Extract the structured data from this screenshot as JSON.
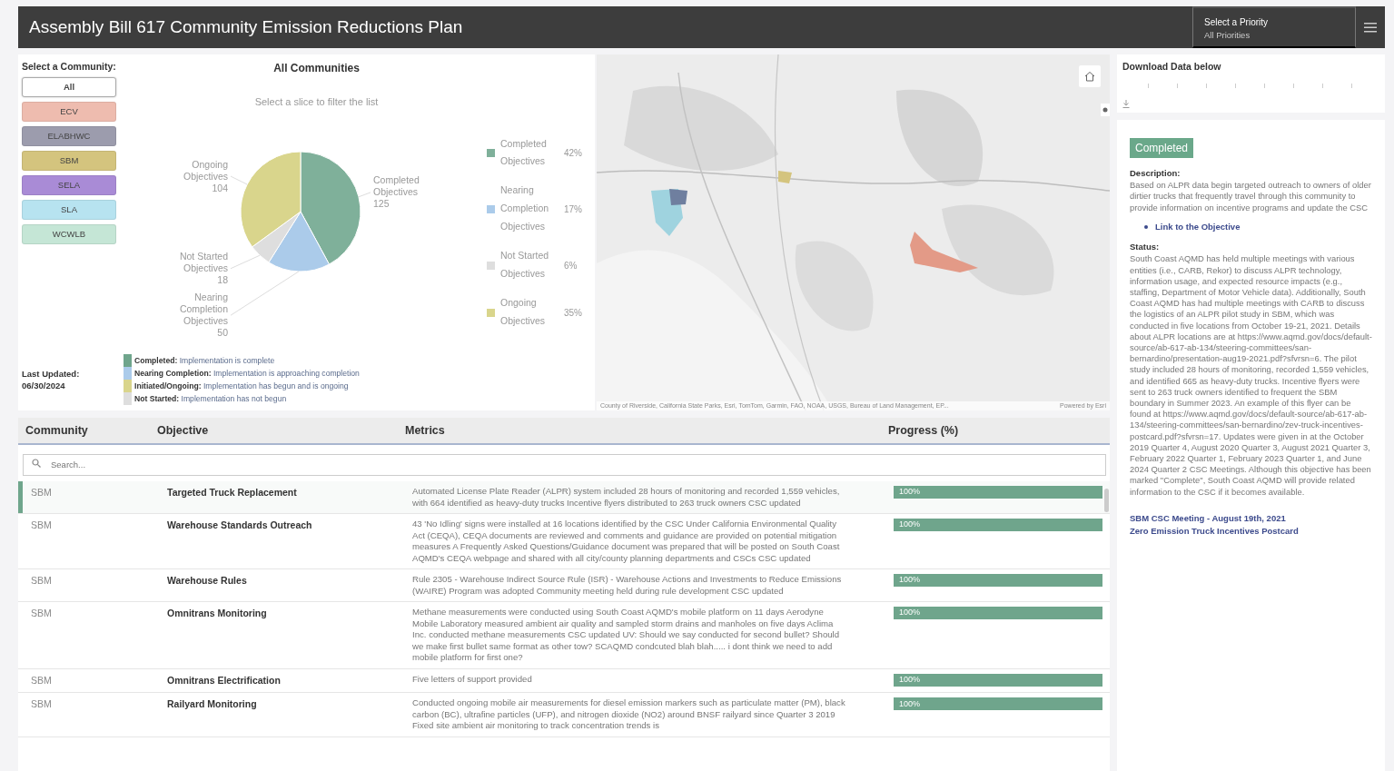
{
  "header": {
    "title": "Assembly Bill 617 Community Emission Reductions Plan",
    "priority_select": {
      "label": "Select a Priority",
      "value": "All Priorities"
    }
  },
  "community_selector": {
    "label": "Select a Community:",
    "options": [
      {
        "label": "All",
        "color": "#ffffff",
        "selected": true
      },
      {
        "label": "ECV",
        "color": "#eebcaf",
        "selected": false
      },
      {
        "label": "ELABHWC",
        "color": "#9c9cad",
        "selected": false
      },
      {
        "label": "SBM",
        "color": "#d4c47e",
        "selected": false
      },
      {
        "label": "SELA",
        "color": "#a98bd6",
        "selected": false
      },
      {
        "label": "SLA",
        "color": "#b7e3f0",
        "selected": false
      },
      {
        "label": "WCWLB",
        "color": "#c5e6d6",
        "selected": false
      }
    ]
  },
  "last_updated": {
    "label": "Last Updated:",
    "value": "06/30/2024"
  },
  "chart": {
    "subtitle": "Select a slice to filter the list",
    "chart_data": {
      "type": "pie",
      "title": "All Communities",
      "categories": [
        "Completed Objectives",
        "Nearing Completion Objectives",
        "Not Started Objectives",
        "Ongoing Objectives"
      ],
      "series": [
        {
          "values": [
            125,
            50,
            18,
            104
          ]
        }
      ],
      "data_labels": true
    },
    "legend": [
      {
        "label": "Completed Objectives",
        "percent": "42%",
        "color": "#7fb09a"
      },
      {
        "label": "Nearing Completion Objectives",
        "percent": "17%",
        "color": "#abcbea"
      },
      {
        "label": "Not Started Objectives",
        "percent": "6%",
        "color": "#dedede"
      },
      {
        "label": "Ongoing Objectives",
        "percent": "35%",
        "color": "#d9d58c"
      }
    ]
  },
  "status_key": [
    {
      "text": "**Completed:** Implementation is complete",
      "color": "#6fa58c"
    },
    {
      "text": "**Nearing Completion:** Implementation is approaching completion",
      "color": "#abcbea"
    },
    {
      "text": "**Initiated/Ongoing:** Implementation has begun and is ongoing",
      "color": "#d9d58c"
    },
    {
      "text": "**Not Started:** Implementation has not begun",
      "color": "#dedede"
    }
  ],
  "map": {
    "kind": "picture",
    "attribution": "County of Riverside, California State Parks, Esri, TomTom, Garmin, FAO, NOAA, USGS, Bureau of Land Management, EP...",
    "credit": "Powered by Esri"
  },
  "table": {
    "columns": [
      "Community",
      "Objective",
      "Metrics",
      "Progress (%)"
    ],
    "search": {
      "placeholder": "Search..."
    },
    "rows": [
      {
        "community": "SBM",
        "objective": "Targeted Truck Replacement",
        "metrics": "Automated License Plate Reader (ALPR) system included 28 hours of monitoring and recorded 1,559 vehicles, with 664 identified as heavy-duty trucks Incentive flyers distributed to 263 truck owners CSC updated",
        "progress": {
          "level": 1,
          "reading": "100%"
        },
        "selected": true
      },
      {
        "community": "SBM",
        "objective": "Warehouse Standards Outreach",
        "metrics": "43 'No Idling' signs were installed at 16 locations identified by the CSC Under California Environmental Quality Act (CEQA), CEQA documents are reviewed and comments and guidance are provided on potential mitigation measures A Frequently Asked Questions/Guidance document was prepared that will be posted on South Coast AQMD's CEQA webpage and shared with all city/county planning departments and CSCs CSC updated",
        "progress": {
          "level": 1,
          "reading": "100%"
        },
        "selected": false
      },
      {
        "community": "SBM",
        "objective": "Warehouse Rules",
        "metrics": "Rule 2305 - Warehouse Indirect Source Rule (ISR) - Warehouse Actions and Investments to Reduce Emissions (WAIRE) Program was adopted Community meeting held during rule development CSC updated",
        "progress": {
          "level": 1,
          "reading": "100%"
        },
        "selected": false
      },
      {
        "community": "SBM",
        "objective": "Omnitrans Monitoring",
        "metrics": "Methane measurements were conducted using South Coast AQMD's mobile platform on 11 days Aerodyne Mobile Laboratory measured ambient air quality and sampled storm drains and manholes on five days Aclima Inc. conducted methane measurements CSC updated UV: Should we say conducted for second bullet? Should we make first bullet same format as other tow? SCAQMD condcuted blah blah..... i dont think we need to add mobile platform for first one?",
        "progress": {
          "level": 1,
          "reading": "100%"
        },
        "selected": false
      },
      {
        "community": "SBM",
        "objective": "Omnitrans Electrification",
        "metrics": "Five letters of support provided",
        "progress": {
          "level": 1,
          "reading": "100%"
        },
        "selected": false
      },
      {
        "community": "SBM",
        "objective": "Railyard Monitoring",
        "metrics": "Conducted ongoing mobile air measurements for diesel emission markers such as particulate matter (PM), black carbon (BC), ultrafine particles (UFP), and nitrogen dioxide (NO2) around BNSF railyard since Quarter 3 2019 Fixed site ambient air monitoring to track concentration trends is",
        "progress": {
          "level": 1,
          "reading": "100%"
        },
        "selected": false
      }
    ]
  },
  "download": {
    "title": "Download Data below"
  },
  "detail": {
    "badge": "Completed",
    "description_label": "Description:",
    "description": "Based on ALPR data begin targeted outreach to owners of older dirtier trucks that frequently travel through this community to provide information on incentive programs and update the CSC",
    "link": "Link to the Objective",
    "status_label": "Status:",
    "status": "South Coast AQMD has held multiple meetings with various entities (i.e., CARB, Rekor) to discuss ALPR technology, information usage, and expected resource impacts (e.g., staffing, Department of Motor Vehicle data). Additionally, South Coast AQMD has had multiple meetings with CARB to discuss the logistics of an ALPR pilot study in SBM, which was conducted in five locations from October 19-21, 2021. Details about ALPR locations are at https://www.aqmd.gov/docs/default-source/ab-617-ab-134/steering-committees/san-bernardino/presentation-aug19-2021.pdf?sfvrsn=6. The pilot study included 28 hours of monitoring, recorded 1,559 vehicles, and identified 665 as heavy-duty trucks. Incentive flyers were sent to 263 truck owners identified to frequent the SBM boundary in Summer 2023. An example of this flyer can be found at https://www.aqmd.gov/docs/default-source/ab-617-ab-134/steering-committees/san-bernardino/zev-truck-incentives-postcard.pdf?sfvrsn=17. Updates were given in at the October 2019 Quarter 4, August 2020 Quarter 3, August 2021 Quarter 3, February 2022 Quarter 1, February 2023 Quarter 1, and June 2024 Quarter 2 CSC Meetings. Although this objective has been marked \"Complete\", South Coast AQMD will provide related information to the CSC if it becomes available.",
    "links": [
      "SBM CSC Meeting - August 19th, 2021",
      "Zero Emission Truck Incentives Postcard"
    ]
  }
}
